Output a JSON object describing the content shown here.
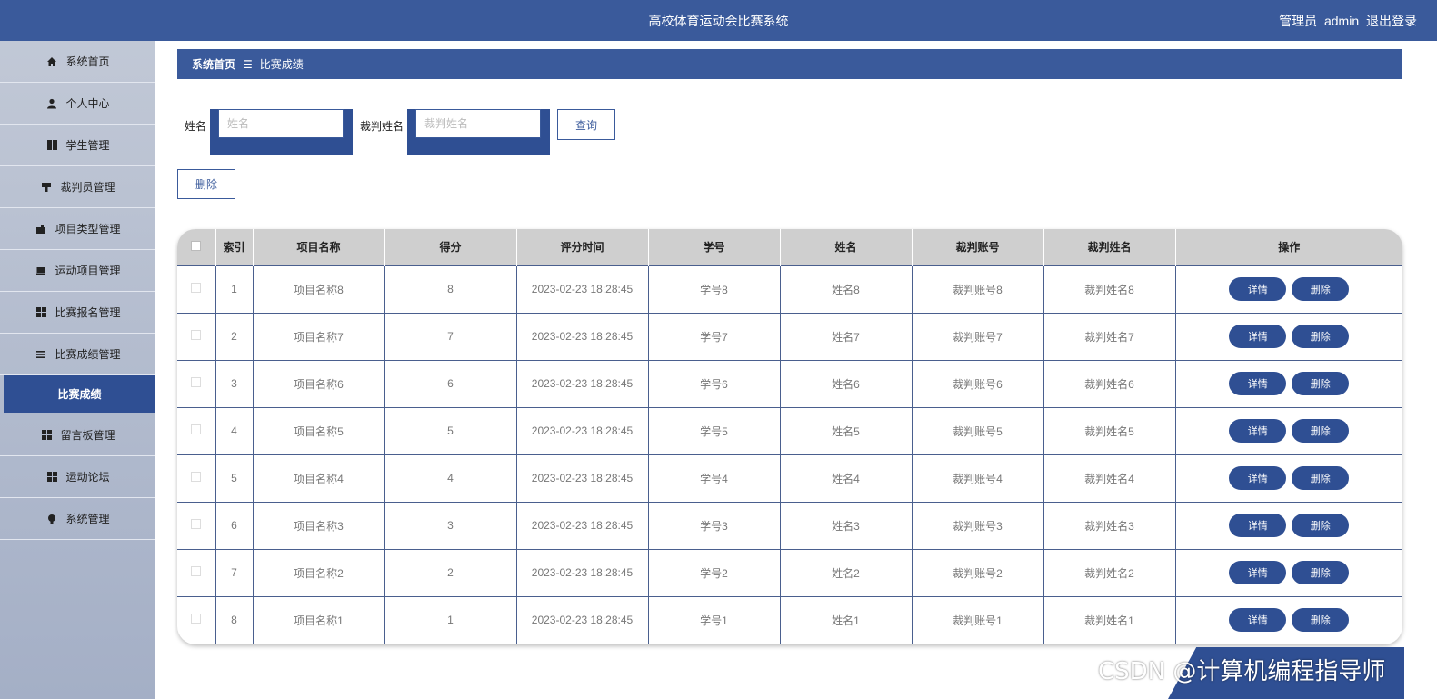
{
  "header": {
    "title": "高校体育运动会比赛系统",
    "role": "管理员",
    "username": "admin",
    "logout": "退出登录"
  },
  "sidebar": {
    "items": [
      {
        "label": "系统首页",
        "icon": "home-icon"
      },
      {
        "label": "个人中心",
        "icon": "user-icon"
      },
      {
        "label": "学生管理",
        "icon": "grid-icon"
      },
      {
        "label": "裁判员管理",
        "icon": "stamp-icon"
      },
      {
        "label": "项目类型管理",
        "icon": "folder-icon"
      },
      {
        "label": "运动项目管理",
        "icon": "tray-icon"
      },
      {
        "label": "比赛报名管理",
        "icon": "grid-icon"
      },
      {
        "label": "比赛成绩管理",
        "icon": "list-icon"
      }
    ],
    "active_sub": "比赛成绩",
    "items_after": [
      {
        "label": "留言板管理",
        "icon": "grid-icon"
      },
      {
        "label": "运动论坛",
        "icon": "grid-icon"
      },
      {
        "label": "系统管理",
        "icon": "bulb-icon"
      }
    ]
  },
  "breadcrumb": {
    "home": "系统首页",
    "sep": "☰",
    "current": "比赛成绩"
  },
  "search": {
    "name_label": "姓名",
    "name_placeholder": "姓名",
    "judge_label": "裁判姓名",
    "judge_placeholder": "裁判姓名",
    "query_button": "查询"
  },
  "delete_button": "删除",
  "table": {
    "columns": [
      "索引",
      "项目名称",
      "得分",
      "评分时间",
      "学号",
      "姓名",
      "裁判账号",
      "裁判姓名",
      "操作"
    ],
    "rows": [
      [
        "1",
        "项目名称8",
        "8",
        "2023-02-23 18:28:45",
        "学号8",
        "姓名8",
        "裁判账号8",
        "裁判姓名8"
      ],
      [
        "2",
        "项目名称7",
        "7",
        "2023-02-23 18:28:45",
        "学号7",
        "姓名7",
        "裁判账号7",
        "裁判姓名7"
      ],
      [
        "3",
        "项目名称6",
        "6",
        "2023-02-23 18:28:45",
        "学号6",
        "姓名6",
        "裁判账号6",
        "裁判姓名6"
      ],
      [
        "4",
        "项目名称5",
        "5",
        "2023-02-23 18:28:45",
        "学号5",
        "姓名5",
        "裁判账号5",
        "裁判姓名5"
      ],
      [
        "5",
        "项目名称4",
        "4",
        "2023-02-23 18:28:45",
        "学号4",
        "姓名4",
        "裁判账号4",
        "裁判姓名4"
      ],
      [
        "6",
        "项目名称3",
        "3",
        "2023-02-23 18:28:45",
        "学号3",
        "姓名3",
        "裁判账号3",
        "裁判姓名3"
      ],
      [
        "7",
        "项目名称2",
        "2",
        "2023-02-23 18:28:45",
        "学号2",
        "姓名2",
        "裁判账号2",
        "裁判姓名2"
      ],
      [
        "8",
        "项目名称1",
        "1",
        "2023-02-23 18:28:45",
        "学号1",
        "姓名1",
        "裁判账号1",
        "裁判姓名1"
      ]
    ],
    "detail_label": "详情",
    "delete_label": "删除"
  },
  "watermark": "CSDN @计算机编程指导师"
}
